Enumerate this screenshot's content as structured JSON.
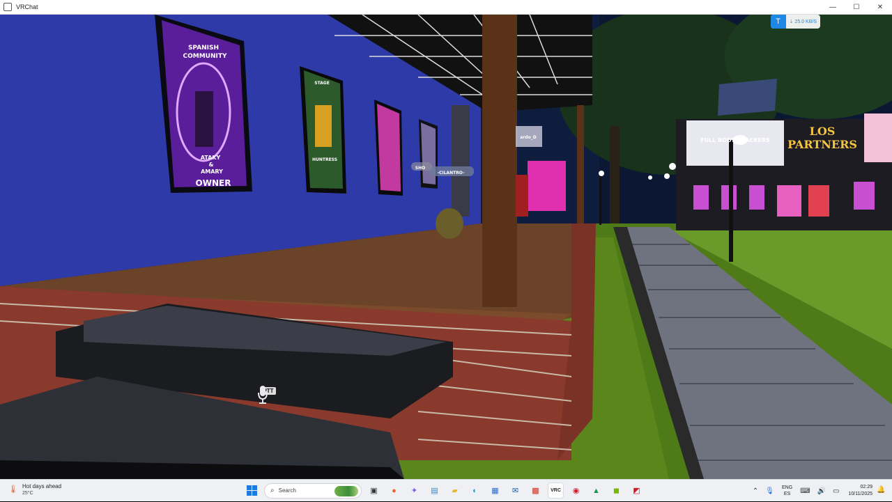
{
  "window": {
    "title": "VRChat",
    "minimize": "—",
    "maximize": "☐",
    "close": "✕"
  },
  "overlay": {
    "download_icon": "T",
    "download_rate": "⇣ 25.0 KB/S",
    "ptt_label": "PTT"
  },
  "scene": {
    "poster1_lines": [
      "SPANISH",
      "COMMUNITY",
      "ATAKY",
      "&",
      "AMARY",
      "OWNER"
    ],
    "poster2_lines": [
      "STAGE",
      "HUNTRESS"
    ],
    "sign_los_partners": "LOS\nPARTNERS",
    "sign_full_body": "FULL BODY TRACKERS",
    "nameplate_1": "-CILANTRO-",
    "nameplate_2": "SHO",
    "nameplate_3": "ardo_D"
  },
  "taskbar": {
    "weather_title": "Hot days ahead",
    "weather_temp": "25°C",
    "search_placeholder": "Search",
    "language_line1": "ENG",
    "language_line2": "ES",
    "time": "02:29",
    "date": "10/11/2025"
  },
  "colors": {
    "wall": "#2c3aa6",
    "brick": "#8a3a2c",
    "grass": "#5e8a1e",
    "path": "#6c6f7a",
    "accent": "#1e88e5"
  },
  "icons": [
    "windows-start-icon",
    "search-icon",
    "task-view-icon",
    "firefox-icon",
    "copilot-icon",
    "photos-icon",
    "file-explorer-icon",
    "edge-icon",
    "store-icon",
    "outlook-icon",
    "news-icon",
    "vrchat-icon",
    "app-red-icon",
    "app-green-icon",
    "nvidia-icon",
    "amd-icon"
  ]
}
